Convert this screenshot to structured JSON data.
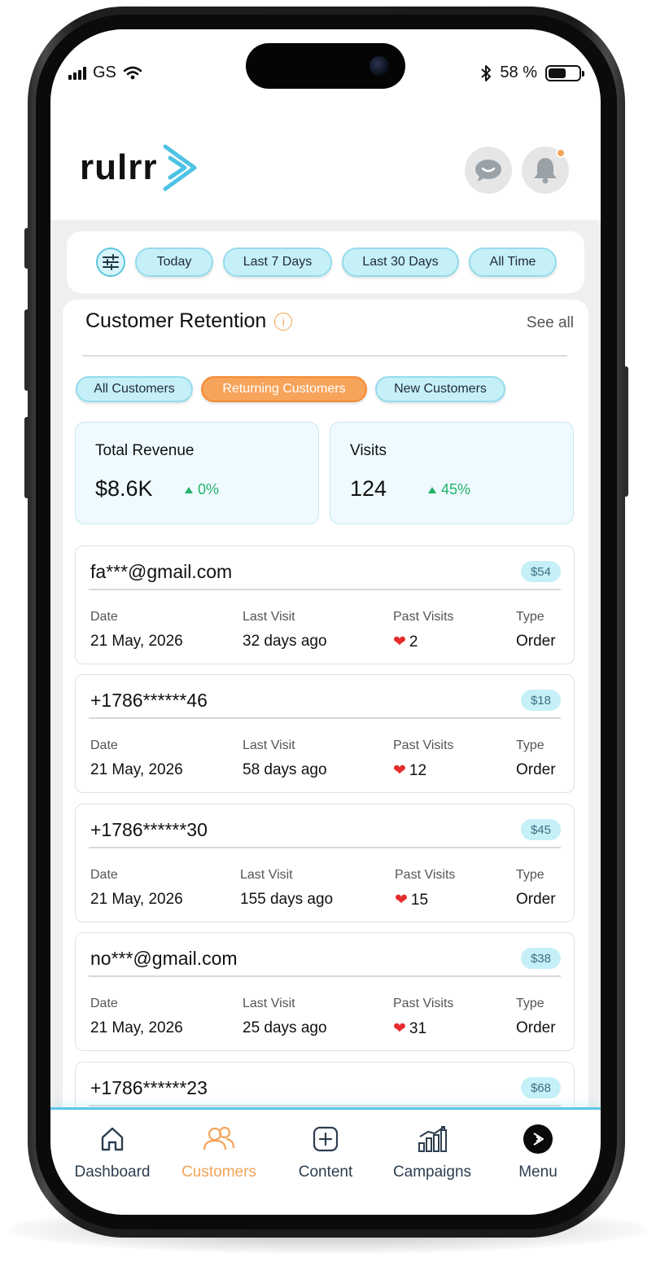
{
  "status_bar": {
    "carrier": "GS",
    "battery_percent": "58 %",
    "battery_level": 0.58
  },
  "header": {
    "logo_text": "rulrr",
    "brand_color": "#4cc3e4",
    "notification_dot": true
  },
  "date_filters": {
    "options": [
      "Today",
      "Last 7 Days",
      "Last 30 Days",
      "All Time"
    ]
  },
  "retention": {
    "title": "Customer Retention",
    "info_symbol": "i",
    "see_all": "See all",
    "segments": [
      {
        "label": "All Customers",
        "active": false
      },
      {
        "label": "Returning Customers",
        "active": true
      },
      {
        "label": "New Customers",
        "active": false
      }
    ],
    "stats": [
      {
        "label": "Total Revenue",
        "value": "$8.6K",
        "delta": "0%"
      },
      {
        "label": "Visits",
        "value": "124",
        "delta": "45%"
      }
    ],
    "column_labels": {
      "date": "Date",
      "last_visit": "Last Visit",
      "past_visits": "Past Visits",
      "type": "Type"
    },
    "customers": [
      {
        "id": "fa***@gmail.com",
        "amount": "$54",
        "date": "21 May, 2026",
        "last_visit": "32 days ago",
        "past_visits": "2",
        "type": "Order"
      },
      {
        "id": "+1786******46",
        "amount": "$18",
        "date": "21 May, 2026",
        "last_visit": "58 days ago",
        "past_visits": "12",
        "type": "Order"
      },
      {
        "id": "+1786******30",
        "amount": "$45",
        "date": "21 May, 2026",
        "last_visit": "155 days ago",
        "past_visits": "15",
        "type": "Order"
      },
      {
        "id": "no***@gmail.com",
        "amount": "$38",
        "date": "21 May, 2026",
        "last_visit": "25 days ago",
        "past_visits": "31",
        "type": "Order"
      },
      {
        "id": "+1786******23",
        "amount": "$68"
      }
    ]
  },
  "bottom_nav": {
    "items": [
      {
        "label": "Dashboard",
        "icon": "home-icon",
        "active": false
      },
      {
        "label": "Customers",
        "icon": "users-icon",
        "active": true
      },
      {
        "label": "Content",
        "icon": "plus-square-icon",
        "active": false
      },
      {
        "label": "Campaigns",
        "icon": "bar-chart-icon",
        "active": false
      },
      {
        "label": "Menu",
        "icon": "menu-logo-icon",
        "active": false
      }
    ],
    "active_color": "#f3a359"
  }
}
